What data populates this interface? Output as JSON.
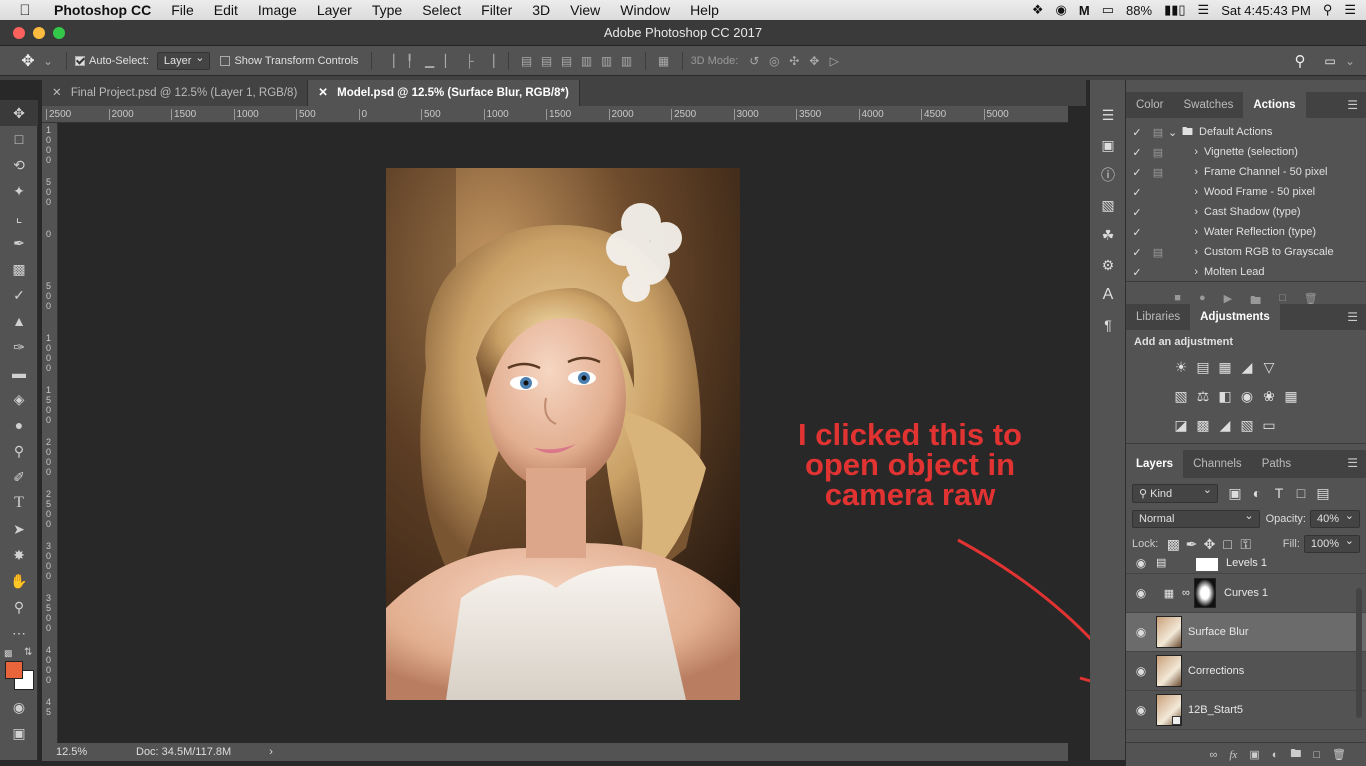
{
  "menubar": {
    "app": "Photoshop CC",
    "items": [
      "File",
      "Edit",
      "Image",
      "Layer",
      "Type",
      "Select",
      "Filter",
      "3D",
      "View",
      "Window",
      "Help"
    ],
    "battery": "88%",
    "clock": "Sat 4:45:43 PM"
  },
  "window": {
    "title": "Adobe Photoshop CC 2017"
  },
  "options": {
    "auto_select_label": "Auto-Select:",
    "auto_select_value": "Layer",
    "transform_label": "Show Transform Controls",
    "mode_3d_label": "3D Mode:"
  },
  "tabs": [
    {
      "label": "Final Project.psd @ 12.5% (Layer 1, RGB/8)"
    },
    {
      "label": "Model.psd @ 12.5% (Surface Blur, RGB/8*)"
    }
  ],
  "ruler": {
    "h_labels": [
      "2500",
      "2000",
      "1500",
      "1000",
      "500",
      "0",
      "500",
      "1000",
      "1500",
      "2000",
      "2500",
      "3000",
      "3500",
      "4000",
      "4500",
      "5000"
    ],
    "v_labels": [
      "1 0 0 0",
      "5 0 0",
      "0",
      "5 0 0",
      "1 0 0 0",
      "1 5 0 0",
      "2 0 0 0",
      "2 5 0 0",
      "3 0 0 0",
      "3 5 0 0",
      "4 0 0 0",
      "4 5"
    ]
  },
  "status": {
    "zoom": "12.5%",
    "doc": "Doc: 34.5M/117.8M"
  },
  "annotation": {
    "text": "I clicked this to open object in camera raw",
    "color": "#e23333"
  },
  "color_panel": {
    "tabs": [
      "Color",
      "Swatches",
      "Actions"
    ],
    "actions": [
      {
        "name": "Default Actions"
      },
      {
        "name": "Vignette (selection)"
      },
      {
        "name": "Frame Channel - 50 pixel"
      },
      {
        "name": "Wood Frame - 50 pixel"
      },
      {
        "name": "Cast Shadow (type)"
      },
      {
        "name": "Water Reflection (type)"
      },
      {
        "name": "Custom RGB to Grayscale"
      },
      {
        "name": "Molten Lead"
      }
    ]
  },
  "adjust_panel": {
    "tabs": [
      "Libraries",
      "Adjustments"
    ],
    "heading": "Add an adjustment"
  },
  "layers_panel": {
    "tabs": [
      "Layers",
      "Channels",
      "Paths"
    ],
    "kind_label": "Kind",
    "blend_mode": "Normal",
    "opacity_label": "Opacity:",
    "opacity": "40%",
    "lock_label": "Lock:",
    "fill_label": "Fill:",
    "fill": "100%",
    "layers": [
      {
        "name": "Levels 1"
      },
      {
        "name": "Curves 1"
      },
      {
        "name": "Surface Blur"
      },
      {
        "name": "Corrections"
      },
      {
        "name": "12B_Start5"
      }
    ]
  },
  "colors": {
    "foreground": "#e8643a",
    "background": "#ffffff",
    "accent": "#e23333"
  }
}
